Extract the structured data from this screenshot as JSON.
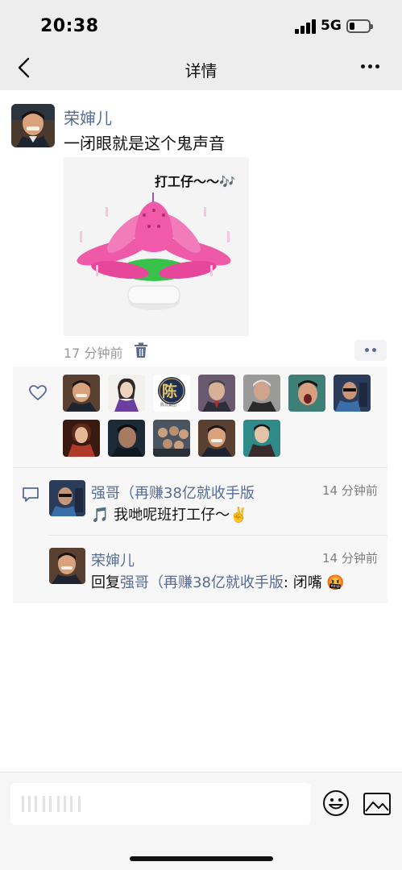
{
  "status_bar": {
    "time": "20:38",
    "network": "5G"
  },
  "nav": {
    "title": "详情"
  },
  "post": {
    "author": "荣婶儿",
    "text": "一闭眼就是这个鬼声音",
    "image_caption": "打工仔～～🎶",
    "time": "17 分钟前"
  },
  "likes": {
    "count_shown": 12,
    "avatar_labels": [
      "陈"
    ],
    "avatar_sublabel": "陈氏集团"
  },
  "comments": [
    {
      "author": "强哥（再赚38亿就收手版",
      "time": "14 分钟前",
      "text": "🎵 我哋呢班打工仔～✌️"
    },
    {
      "author": "荣婶儿",
      "time": "14 分钟前",
      "reply_prefix": "回复",
      "reply_to": "强哥（再赚38亿就收手版",
      "text": ": 闭嘴 🤬"
    }
  ],
  "colors": {
    "link": "#576b95",
    "nav_bg": "#ededed",
    "panel_bg": "#f7f7f7"
  },
  "icons": [
    "back-icon",
    "more-icon",
    "trash-icon",
    "heart-icon",
    "comment-icon",
    "emoji-icon",
    "image-icon"
  ]
}
